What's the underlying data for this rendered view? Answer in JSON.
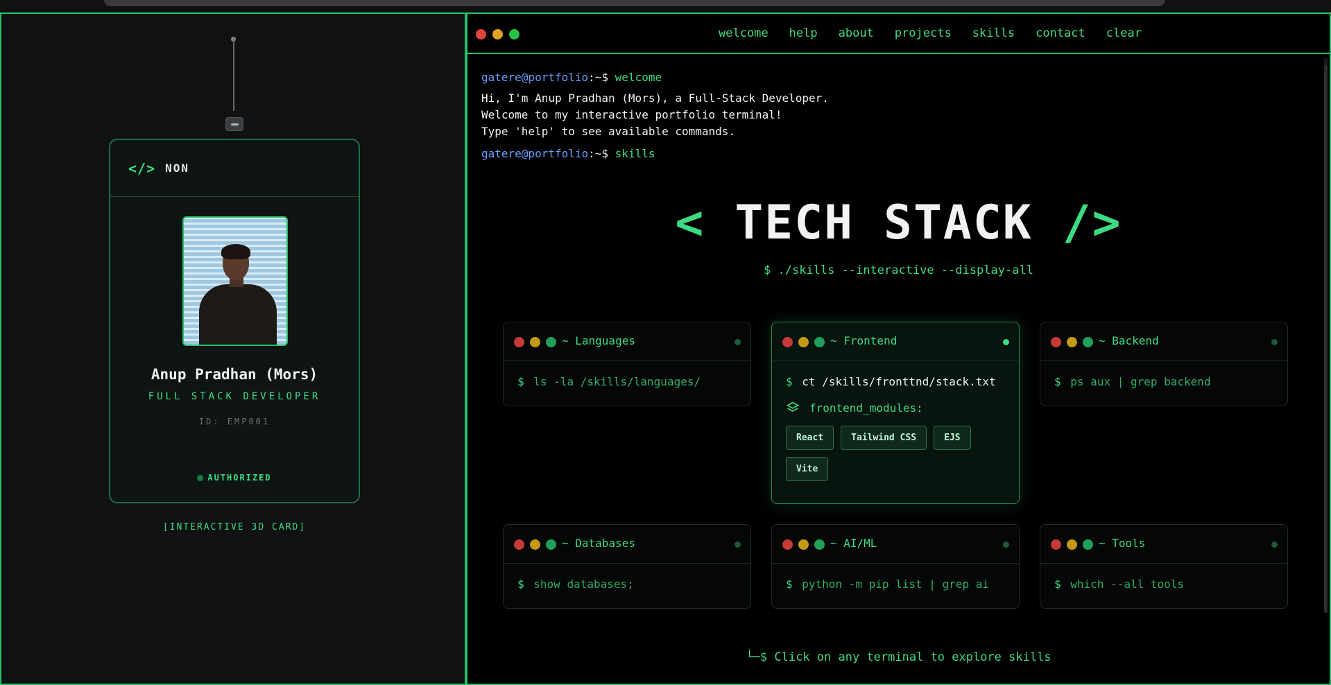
{
  "badge": {
    "brand": "NON",
    "name": "Anup Pradhan (Mors)",
    "role": "FULL STACK DEVELOPER",
    "id": "ID: EMP001",
    "status": "AUTHORIZED",
    "caption": "[INTERACTIVE 3D CARD]"
  },
  "nav": [
    "welcome",
    "help",
    "about",
    "projects",
    "skills",
    "contact",
    "clear"
  ],
  "terminal": {
    "prompt_user": "gatere@portfolio",
    "prompt_sep": ":~$",
    "cmd1": "welcome",
    "welcome_lines": [
      "Hi, I'm Anup Pradhan (Mors), a Full-Stack Developer.",
      "Welcome to my interactive portfolio terminal!",
      "Type 'help' to see available commands."
    ],
    "cmd2": "skills"
  },
  "tech_stack": {
    "heading_left": "<",
    "heading": "TECH STACK",
    "heading_right": "/>",
    "subtitle": "$ ./skills --interactive --display-all",
    "footer": "└─$ Click on any terminal to explore skills"
  },
  "skills": [
    {
      "title": "~ Languages",
      "command": "ls -la /skills/languages/"
    },
    {
      "title": "~ Frontend",
      "command": "ct /skills/fronttnd/stack.txt",
      "modules_label": "frontend_modules:",
      "tags": [
        "React",
        "Tailwind CSS",
        "EJS",
        "Vite"
      ]
    },
    {
      "title": "~ Backend",
      "command": "ps aux | grep backend"
    },
    {
      "title": "~ Databases",
      "command": "show databases;"
    },
    {
      "title": "~ AI/ML",
      "command": "python -m pip list | grep ai"
    },
    {
      "title": "~ Tools",
      "command": "which --all tools"
    }
  ],
  "colors": {
    "accent": "#3ddc84",
    "prompt_user": "#6aa0ff"
  }
}
